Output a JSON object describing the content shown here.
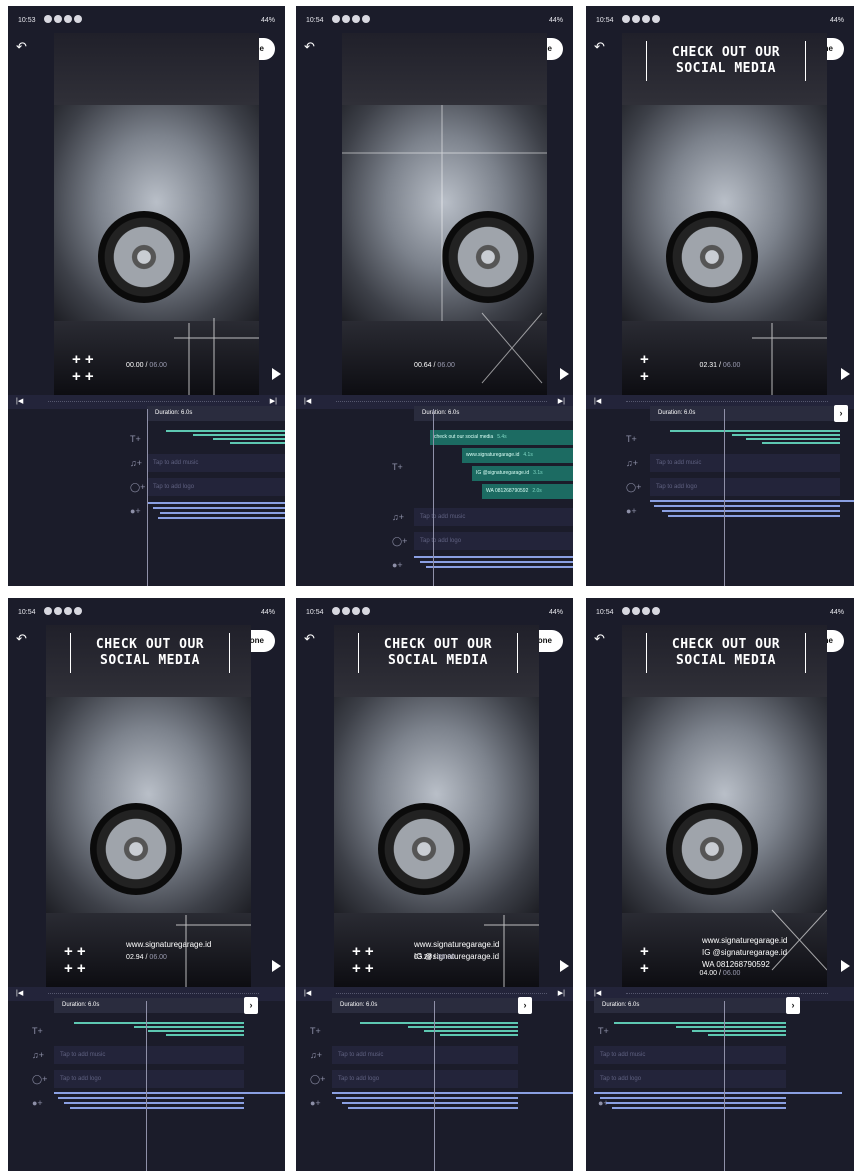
{
  "colors": {
    "background": "#1b1c2a",
    "text_track": "#5ec8b2",
    "logo_track": "#8a9fe2",
    "done_button": "#ffffff"
  },
  "common": {
    "done_label": "Done",
    "duration_label": "Duration: 6.0s",
    "music_placeholder": "Tap to add music",
    "logo_placeholder": "Tap to add logo",
    "total_time": "06.00",
    "battery": "44%",
    "icons": [
      "undo-icon",
      "text-add-icon",
      "music-add-icon",
      "logo-add-icon",
      "sticker-add-icon",
      "play-icon",
      "skip-start-icon",
      "skip-end-icon",
      "chevron-right-icon"
    ]
  },
  "headline": {
    "line1": "CHECK OUT OUR",
    "line2": "SOCIAL MEDIA"
  },
  "social": {
    "web": "www.signaturegarage.id",
    "ig": "IG @signaturegarage.id",
    "wa": "WA 081268790592"
  },
  "chips": [
    {
      "label": "check out our social media",
      "dur": "5.4s"
    },
    {
      "label": "www.signaturegarage.id",
      "dur": "4.1s"
    },
    {
      "label": "IG @signaturegarage.id",
      "dur": "3.1s"
    },
    {
      "label": "WA 081268790592",
      "dur": "2.0s"
    }
  ],
  "panels": [
    {
      "clock": "10:53",
      "time": "00.00"
    },
    {
      "clock": "10:54",
      "time": "00.64"
    },
    {
      "clock": "10:54",
      "time": "02.31"
    },
    {
      "clock": "10:54",
      "time": "02.94"
    },
    {
      "clock": "10:54",
      "time": "03.28"
    },
    {
      "clock": "10:54",
      "time": "04.00"
    }
  ]
}
